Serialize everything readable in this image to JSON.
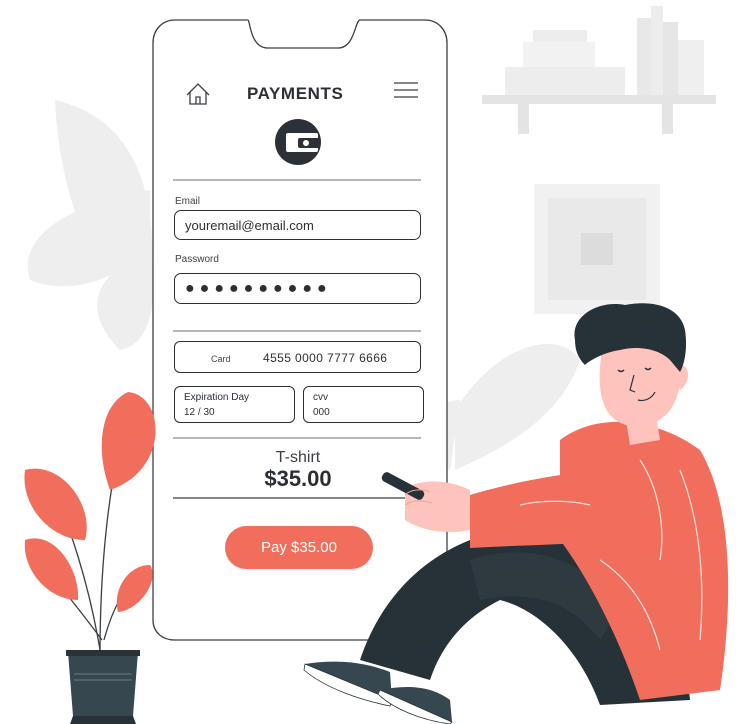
{
  "header": {
    "title": "PAYMENTS",
    "home_icon": "home-icon",
    "menu_icon": "hamburger-menu-icon"
  },
  "form": {
    "email_label": "Email",
    "email_value": "youremail@email.com",
    "password_label": "Password",
    "password_value": "●●●●●●●●●●",
    "card_label": "Card",
    "card_number": "4555 0000 7777 6666",
    "expiration_label": "Expiration Day",
    "expiration_value": "12 / 30",
    "cvv_label": "cvv",
    "cvv_value": "000"
  },
  "order": {
    "product": "T-shirt",
    "price": "$35.00"
  },
  "actions": {
    "pay_label": "Pay $35.00"
  },
  "colors": {
    "accent": "#f06e5b",
    "dark": "#263238",
    "light_gray": "#ebebeb"
  }
}
